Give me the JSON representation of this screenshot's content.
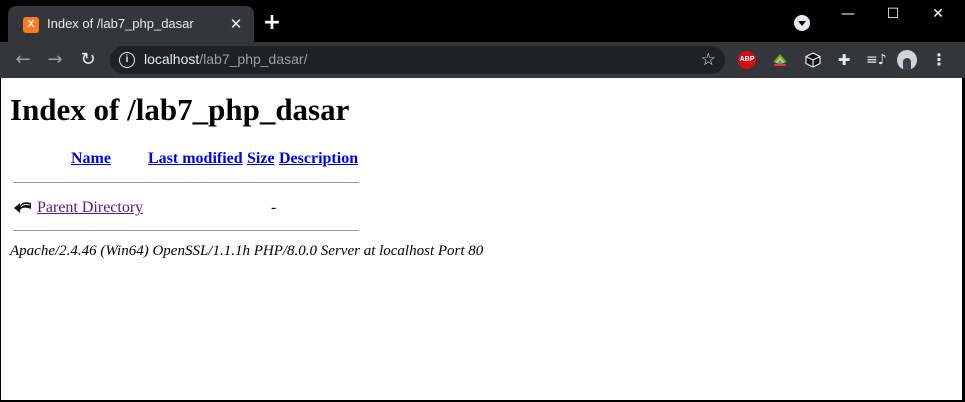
{
  "browser": {
    "tab_title": "Index of /lab7_php_dasar",
    "favicon_text": "X",
    "url_host": "localhost",
    "url_path": "/lab7_php_dasar/",
    "extensions": {
      "abp_label": "ABP"
    },
    "icons": [
      "xampp-favicon",
      "close-icon",
      "plus-icon",
      "tab-search-icon",
      "minimize-icon",
      "maximize-icon",
      "close-window-icon",
      "back-arrow-icon",
      "forward-arrow-icon",
      "reload-icon",
      "info-icon",
      "star-icon",
      "adblock-icon",
      "colorful-extension-icon",
      "cube-icon",
      "puzzle-icon",
      "media-queue-icon",
      "avatar",
      "kebab-menu-icon"
    ]
  },
  "page": {
    "heading": "Index of /lab7_php_dasar",
    "columns": {
      "name": "Name",
      "last_modified": "Last modified",
      "size": "Size",
      "description": "Description"
    },
    "rows": [
      {
        "icon": "back-icon",
        "name": "Parent Directory",
        "last_modified": "",
        "size": "-",
        "description": ""
      }
    ],
    "address": "Apache/2.4.46 (Win64) OpenSSL/1.1.1h PHP/8.0.0 Server at localhost Port 80"
  }
}
